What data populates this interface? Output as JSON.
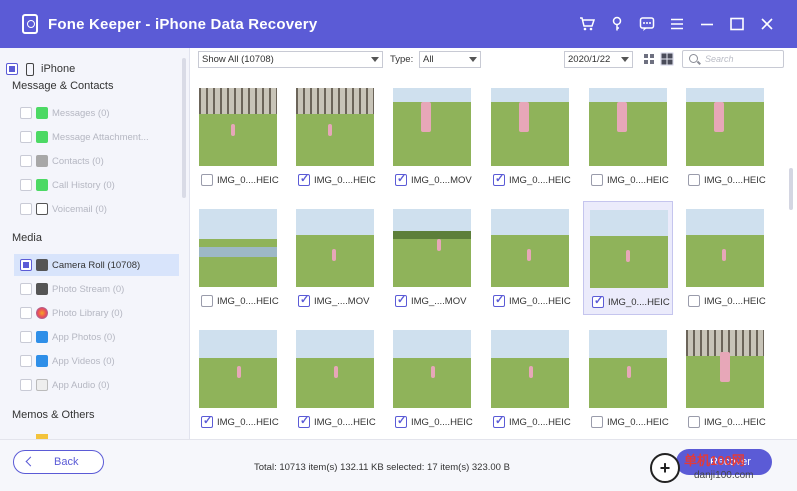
{
  "window": {
    "title": "Fone Keeper - iPhone Data Recovery",
    "icons": [
      "cart-icon",
      "key-icon",
      "chat-icon",
      "menu-icon",
      "minimize-icon",
      "maximize-icon",
      "close-icon"
    ]
  },
  "sidebar": {
    "device": "iPhone",
    "sections": [
      {
        "title": "Message & Contacts",
        "items": [
          {
            "label": "Messages (0)",
            "icon": "messages-icon",
            "color": "#4cd964"
          },
          {
            "label": "Message Attachment...",
            "icon": "attachment-icon",
            "color": "#4cd964"
          },
          {
            "label": "Contacts (0)",
            "icon": "contacts-icon",
            "color": "#a8a8a8"
          },
          {
            "label": "Call History (0)",
            "icon": "phone-icon",
            "color": "#4cd964"
          },
          {
            "label": "Voicemail (0)",
            "icon": "voicemail-icon",
            "color": "#555555"
          }
        ]
      },
      {
        "title": "Media",
        "items": [
          {
            "label": "Camera Roll (10708)",
            "icon": "camera-icon",
            "color": "#555555",
            "active": true
          },
          {
            "label": "Photo Stream (0)",
            "icon": "photo-stream-icon",
            "color": "#555555"
          },
          {
            "label": "Photo Library (0)",
            "icon": "photo-library-icon",
            "color": "#f5a623"
          },
          {
            "label": "App Photos (0)",
            "icon": "app-photos-icon",
            "color": "#2f8fe8"
          },
          {
            "label": "App Videos (0)",
            "icon": "app-videos-icon",
            "color": "#2f8fe8"
          },
          {
            "label": "App Audio (0)",
            "icon": "app-audio-icon",
            "color": "#e8e8e8"
          }
        ]
      },
      {
        "title": "Memos & Others",
        "items": []
      }
    ]
  },
  "toolbar": {
    "filter_value": "Show All (10708)",
    "type_label": "Type:",
    "type_value": "All",
    "date_value": "2020/1/22",
    "search_placeholder": "Search"
  },
  "grid": {
    "items": [
      {
        "name": "IMG_0....HEIC",
        "checked": false,
        "scene": "trees"
      },
      {
        "name": "IMG_0....HEIC",
        "checked": true,
        "scene": "trees"
      },
      {
        "name": "IMG_0....MOV",
        "checked": true,
        "scene": "kid-close"
      },
      {
        "name": "IMG_0....HEIC",
        "checked": true,
        "scene": "kid-close"
      },
      {
        "name": "IMG_0....HEIC",
        "checked": false,
        "scene": "kid-close"
      },
      {
        "name": "IMG_0....HEIC",
        "checked": false,
        "scene": "kid-close"
      },
      {
        "name": "IMG_0....HEIC",
        "checked": false,
        "scene": "water"
      },
      {
        "name": "IMG_....MOV",
        "checked": true,
        "scene": "field-far"
      },
      {
        "name": "IMG_....MOV",
        "checked": true,
        "scene": "field-trees"
      },
      {
        "name": "IMG_0....HEIC",
        "checked": true,
        "scene": "field-far"
      },
      {
        "name": "IMG_0....HEIC",
        "checked": true,
        "scene": "field-far",
        "selected": true
      },
      {
        "name": "IMG_0....HEIC",
        "checked": false,
        "scene": "field-far"
      },
      {
        "name": "IMG_0....HEIC",
        "checked": true,
        "scene": "field"
      },
      {
        "name": "IMG_0....HEIC",
        "checked": true,
        "scene": "field"
      },
      {
        "name": "IMG_0....HEIC",
        "checked": true,
        "scene": "field"
      },
      {
        "name": "IMG_0....HEIC",
        "checked": true,
        "scene": "field"
      },
      {
        "name": "IMG_0....HEIC",
        "checked": false,
        "scene": "field"
      },
      {
        "name": "IMG_0....HEIC",
        "checked": false,
        "scene": "kid-trees"
      }
    ]
  },
  "footer": {
    "back_label": "Back",
    "status": "Total: 10713 item(s) 132.11 KB   selected: 17 item(s) 323.00 B",
    "recover_label": "Recover"
  },
  "watermark": {
    "text": "单机100网",
    "url": "danji100.com"
  },
  "colors": {
    "accent": "#5b5bd6",
    "sidebar_bg": "#f4f5fb",
    "active_item_bg": "#d8e4fb"
  }
}
